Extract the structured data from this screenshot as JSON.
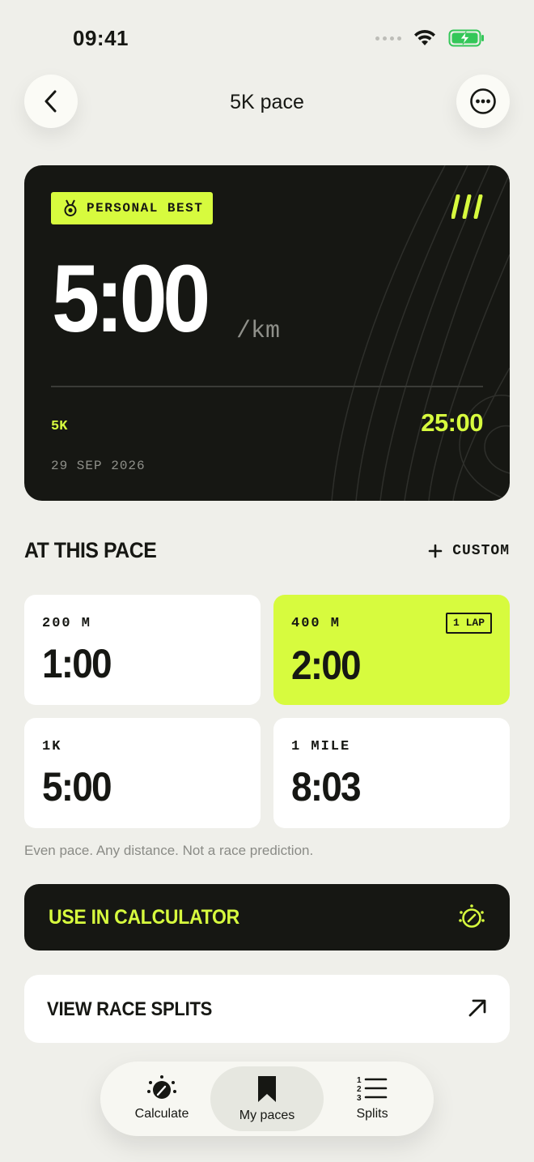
{
  "status_bar": {
    "time": "09:41"
  },
  "header": {
    "title": "5K pace"
  },
  "pb_card": {
    "badge": "PERSONAL BEST",
    "pace": "5:00",
    "unit": "/km",
    "distance": "5K",
    "total_time": "25:00",
    "date": "29 SEP 2026"
  },
  "section": {
    "title": "AT THIS PACE",
    "custom_label": "CUSTOM"
  },
  "tiles": [
    {
      "label": "200 M",
      "value": "1:00"
    },
    {
      "label": "400 M",
      "value": "2:00",
      "badge": "1 LAP"
    },
    {
      "label": "1K",
      "value": "5:00"
    },
    {
      "label": "1 MILE",
      "value": "8:03"
    }
  ],
  "note": "Even pace. Any distance. Not a race prediction.",
  "actions": {
    "primary": "USE IN CALCULATOR",
    "secondary": "VIEW RACE SPLITS"
  },
  "tab_bar": {
    "tabs": [
      {
        "label": "Calculate",
        "icon": "gauge-icon"
      },
      {
        "label": "My paces",
        "icon": "bookmark-icon",
        "active": true
      },
      {
        "label": "Splits",
        "icon": "numbered-list-icon"
      }
    ]
  },
  "colors": {
    "accent": "#d7fb3e",
    "dark": "#161713",
    "background": "#efefea"
  }
}
